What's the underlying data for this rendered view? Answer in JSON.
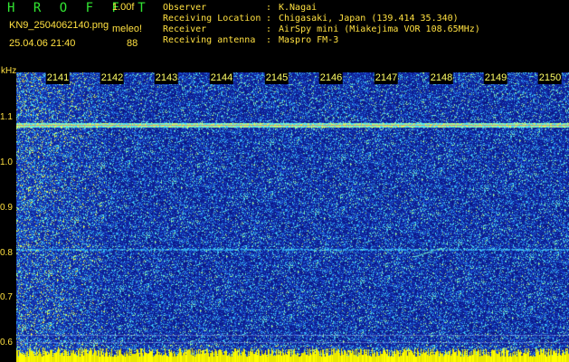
{
  "app": {
    "title": "H R O F F T",
    "version": "1.00f",
    "file_name": "KN9_2504062140.png",
    "datetime": "25.04.06 21:40",
    "mode": "meleo!",
    "count": "88"
  },
  "station_info": [
    {
      "label": "Observer",
      "value": "K.Nagai"
    },
    {
      "label": "Receiving Location",
      "value": "Chigasaki, Japan (139.414 35.340)"
    },
    {
      "label": "Receiver",
      "value": "AirSpy mini (Miakejima VOR 108.65MHz)"
    },
    {
      "label": "Receiving antenna",
      "value": "Maspro FM-3"
    }
  ],
  "time_axis": {
    "labels": [
      "2141",
      "2142",
      "2143",
      "2144",
      "2145",
      "2146",
      "2147",
      "2148",
      "2149",
      "2150"
    ]
  },
  "freq_axis": {
    "unit": "kHz",
    "labels": [
      "1.1",
      "1.0",
      "0.9",
      "0.8",
      "0.7",
      "0.6"
    ],
    "range_khz": [
      0.58,
      1.16
    ]
  },
  "colors": {
    "background": "#000000",
    "header_text": "#ffe040",
    "title_text": "#32e632",
    "spectrum_low": "#0a1aa0",
    "spectrum_high": "#ffff00"
  }
}
